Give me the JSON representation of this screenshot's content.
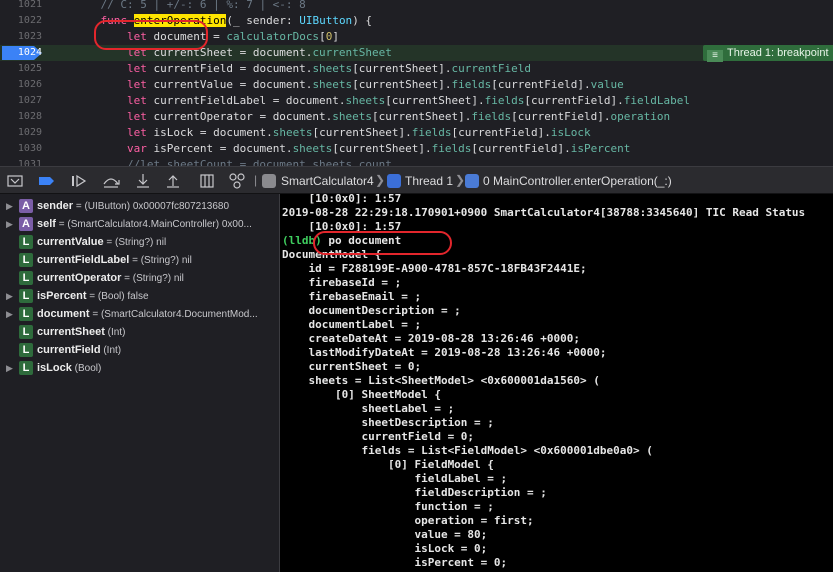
{
  "editor": {
    "lines": [
      {
        "num": "1021",
        "parts": [
          {
            "t": "    ",
            "c": ""
          },
          {
            "t": "// C: 5 | +/-: 6 | %: 7 | <-: 8",
            "c": "cm"
          }
        ]
      },
      {
        "num": "1022",
        "parts": [
          {
            "t": "    ",
            "c": ""
          },
          {
            "t": "func ",
            "c": "kw"
          },
          {
            "t": "enterOperation",
            "c": "hl-fn"
          },
          {
            "t": "(_ sender: ",
            "c": ""
          },
          {
            "t": "UIButton",
            "c": "ty"
          },
          {
            "t": ") {",
            "c": ""
          }
        ]
      },
      {
        "num": "1023",
        "parts": [
          {
            "t": "        ",
            "c": ""
          },
          {
            "t": "let",
            "c": "kw"
          },
          {
            "t": " document = ",
            "c": ""
          },
          {
            "t": "calculatorDocs",
            "c": "prop"
          },
          {
            "t": "[",
            "c": ""
          },
          {
            "t": "0",
            "c": "num"
          },
          {
            "t": "]",
            "c": ""
          }
        ]
      },
      {
        "num": "1024",
        "parts": [
          {
            "t": "        ",
            "c": ""
          },
          {
            "t": "let",
            "c": "kw"
          },
          {
            "t": " currentSheet = document.",
            "c": ""
          },
          {
            "t": "currentSheet",
            "c": "prop"
          }
        ]
      },
      {
        "num": "1025",
        "parts": [
          {
            "t": "        ",
            "c": ""
          },
          {
            "t": "let",
            "c": "kw"
          },
          {
            "t": " currentField = document.",
            "c": ""
          },
          {
            "t": "sheets",
            "c": "prop"
          },
          {
            "t": "[currentSheet].",
            "c": ""
          },
          {
            "t": "currentField",
            "c": "prop"
          }
        ]
      },
      {
        "num": "1026",
        "parts": [
          {
            "t": "        ",
            "c": ""
          },
          {
            "t": "let",
            "c": "kw"
          },
          {
            "t": " currentValue = document.",
            "c": ""
          },
          {
            "t": "sheets",
            "c": "prop"
          },
          {
            "t": "[currentSheet].",
            "c": ""
          },
          {
            "t": "fields",
            "c": "prop"
          },
          {
            "t": "[currentField].",
            "c": ""
          },
          {
            "t": "value",
            "c": "prop"
          }
        ]
      },
      {
        "num": "1027",
        "parts": [
          {
            "t": "        ",
            "c": ""
          },
          {
            "t": "let",
            "c": "kw"
          },
          {
            "t": " currentFieldLabel = document.",
            "c": ""
          },
          {
            "t": "sheets",
            "c": "prop"
          },
          {
            "t": "[currentSheet].",
            "c": ""
          },
          {
            "t": "fields",
            "c": "prop"
          },
          {
            "t": "[currentField].",
            "c": ""
          },
          {
            "t": "fieldLabel",
            "c": "prop"
          }
        ]
      },
      {
        "num": "1028",
        "parts": [
          {
            "t": "        ",
            "c": ""
          },
          {
            "t": "let",
            "c": "kw"
          },
          {
            "t": " currentOperator = document.",
            "c": ""
          },
          {
            "t": "sheets",
            "c": "prop"
          },
          {
            "t": "[currentSheet].",
            "c": ""
          },
          {
            "t": "fields",
            "c": "prop"
          },
          {
            "t": "[currentField].",
            "c": ""
          },
          {
            "t": "operation",
            "c": "prop"
          }
        ]
      },
      {
        "num": "1029",
        "parts": [
          {
            "t": "        ",
            "c": ""
          },
          {
            "t": "let",
            "c": "kw"
          },
          {
            "t": " isLock = document.",
            "c": ""
          },
          {
            "t": "sheets",
            "c": "prop"
          },
          {
            "t": "[currentSheet].",
            "c": ""
          },
          {
            "t": "fields",
            "c": "prop"
          },
          {
            "t": "[currentField].",
            "c": ""
          },
          {
            "t": "isLock",
            "c": "prop"
          }
        ]
      },
      {
        "num": "1030",
        "parts": [
          {
            "t": "        ",
            "c": ""
          },
          {
            "t": "var",
            "c": "kw"
          },
          {
            "t": " isPercent = document.",
            "c": ""
          },
          {
            "t": "sheets",
            "c": "prop"
          },
          {
            "t": "[currentSheet].",
            "c": ""
          },
          {
            "t": "fields",
            "c": "prop"
          },
          {
            "t": "[currentField].",
            "c": ""
          },
          {
            "t": "isPercent",
            "c": "prop"
          }
        ]
      },
      {
        "num": "1031",
        "parts": [
          {
            "t": "        ",
            "c": ""
          },
          {
            "t": "//let sheetCount = document.sheets.count",
            "c": "cm"
          }
        ]
      }
    ],
    "current_line_index": 3,
    "breakpoint_badge": "Thread 1: breakpoint"
  },
  "debug_bar": {
    "breadcrumbs": [
      "SmartCalculator4",
      "Thread 1",
      "0 MainController.enterOperation(_:)"
    ]
  },
  "variables": [
    {
      "badge": "A",
      "expandable": true,
      "name": "sender",
      "value": "= (UIButton) 0x00007fc807213680"
    },
    {
      "badge": "A",
      "expandable": true,
      "name": "self",
      "value": "= (SmartCalculator4.MainController) 0x00..."
    },
    {
      "badge": "L",
      "expandable": false,
      "name": "currentValue",
      "value": "= (String?) nil"
    },
    {
      "badge": "L",
      "expandable": false,
      "name": "currentFieldLabel",
      "value": "= (String?) nil"
    },
    {
      "badge": "L",
      "expandable": false,
      "name": "currentOperator",
      "value": "= (String?) nil"
    },
    {
      "badge": "L",
      "expandable": true,
      "name": "isPercent",
      "value": "= (Bool) false"
    },
    {
      "badge": "L",
      "expandable": true,
      "name": "document",
      "value": "= (SmartCalculator4.DocumentMod..."
    },
    {
      "badge": "L",
      "expandable": false,
      "name": "currentSheet",
      "value": "(Int)"
    },
    {
      "badge": "L",
      "expandable": false,
      "name": "currentField",
      "value": "(Int)"
    },
    {
      "badge": "L",
      "expandable": true,
      "name": "isLock",
      "value": "(Bool)"
    }
  ],
  "console": {
    "lines": [
      "    [10:0x0]: 1:57",
      "2019-08-28 22:29:18.170901+0900 SmartCalculator4[38788:3345640] TIC Read Status",
      "    [10:0x0]: 1:57",
      "(lldb) po document",
      "DocumentModel {",
      "    id = F288199E-A900-4781-857C-18FB43F2441E;",
      "    firebaseId = ;",
      "    firebaseEmail = ;",
      "    documentDescription = ;",
      "    documentLabel = ;",
      "    createDateAt = 2019-08-28 13:26:46 +0000;",
      "    lastModifyDateAt = 2019-08-28 13:26:46 +0000;",
      "    currentSheet = 0;",
      "    sheets = List<SheetModel> <0x600001da1560> (",
      "        [0] SheetModel {",
      "            sheetLabel = ;",
      "            sheetDescription = ;",
      "            currentField = 0;",
      "            fields = List<FieldModel> <0x600001dbe0a0> (",
      "                [0] FieldModel {",
      "                    fieldLabel = ;",
      "                    fieldDescription = ;",
      "                    function = ;",
      "                    operation = first;",
      "                    value = 80;",
      "                    isLock = 0;",
      "                    isPercent = 0;"
    ]
  },
  "colors": {
    "annotation_red": "#e3262c",
    "breakpoint_blue": "#3b82f6",
    "current_line_green": "#243428"
  }
}
